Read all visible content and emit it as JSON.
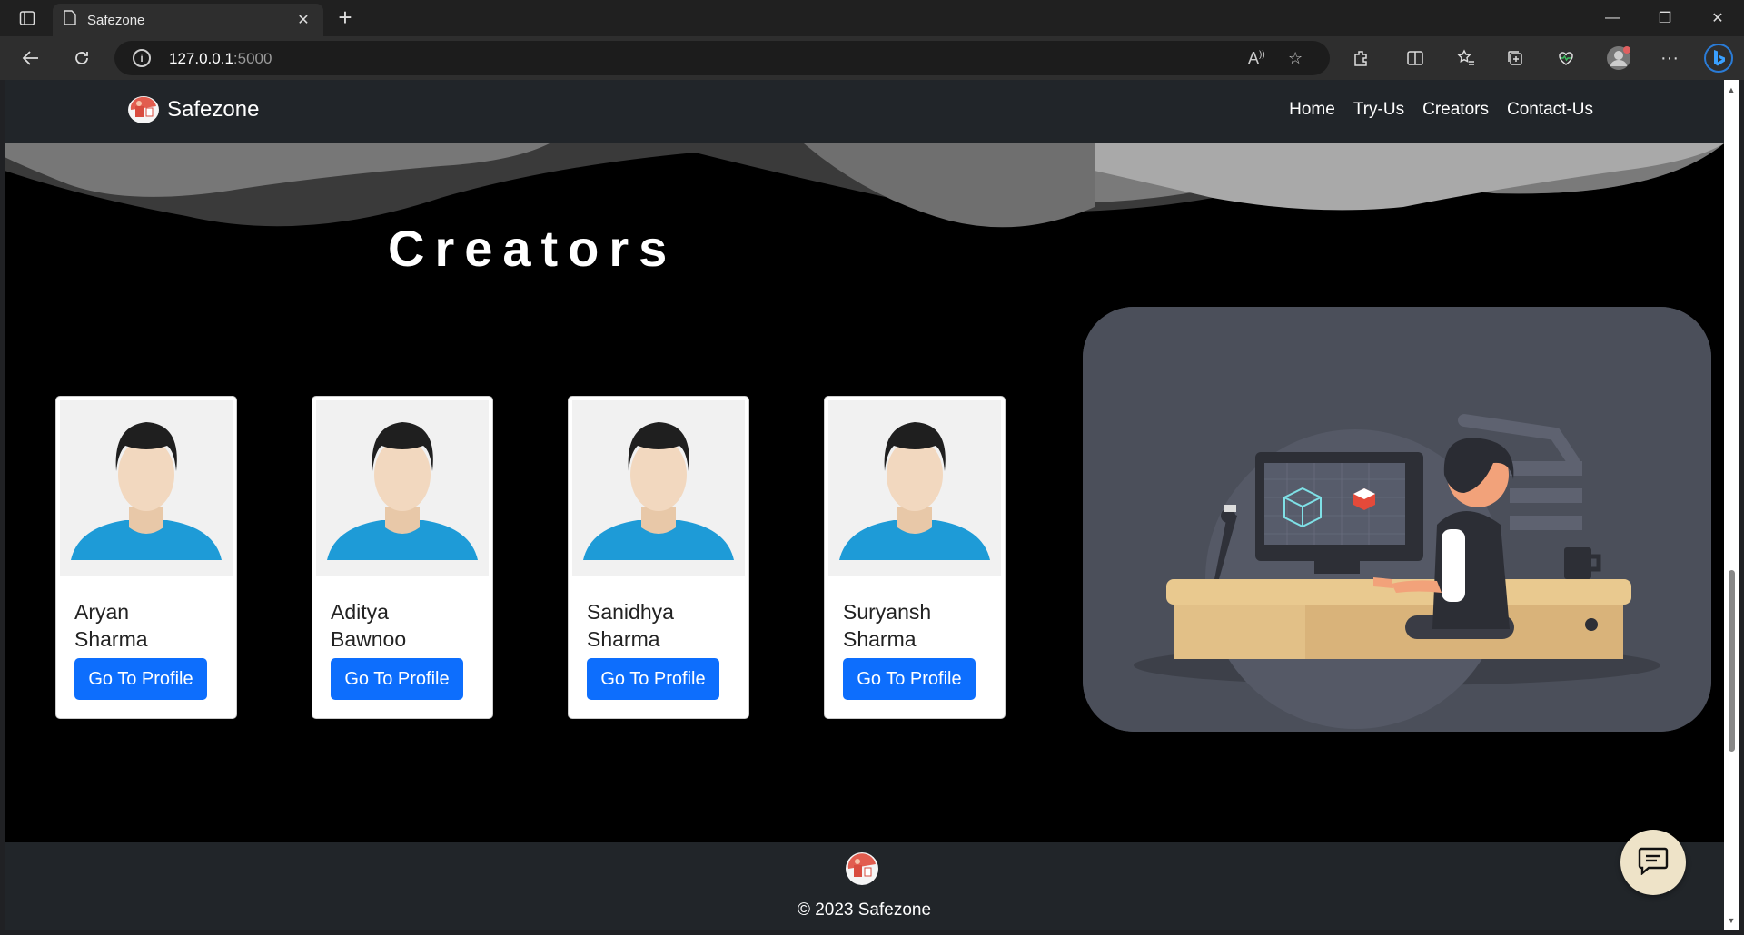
{
  "browser": {
    "tab_title": "Safezone",
    "url_host": "127.0.0.1",
    "url_port": ":5000"
  },
  "nav": {
    "brand": "Safezone",
    "links": [
      "Home",
      "Try-Us",
      "Creators",
      "Contact-Us"
    ]
  },
  "page": {
    "title": "Creators"
  },
  "creators": [
    {
      "first": "Aryan",
      "last": "Sharma",
      "button": "Go To Profile"
    },
    {
      "first": "Aditya",
      "last": "Bawnoo",
      "button": "Go To Profile"
    },
    {
      "first": "Sanidhya",
      "last": "Sharma",
      "button": "Go To Profile"
    },
    {
      "first": "Suryansh",
      "last": "Sharma",
      "button": "Go To Profile"
    }
  ],
  "footer": {
    "copyright": "© 2023 Safezone"
  },
  "colors": {
    "accent": "#0d6efd",
    "nav_bg": "#212529",
    "chat_bg": "#eee3c8"
  },
  "icons": [
    "sidebar-icon",
    "page-icon",
    "close-icon",
    "plus-icon",
    "back-icon",
    "refresh-icon",
    "info-icon",
    "read-aloud-icon",
    "star-icon",
    "extensions-icon",
    "split-icon",
    "favorites-icon",
    "collections-icon",
    "health-icon",
    "profile-icon",
    "more-icon",
    "bing-icon",
    "chat-icon"
  ]
}
